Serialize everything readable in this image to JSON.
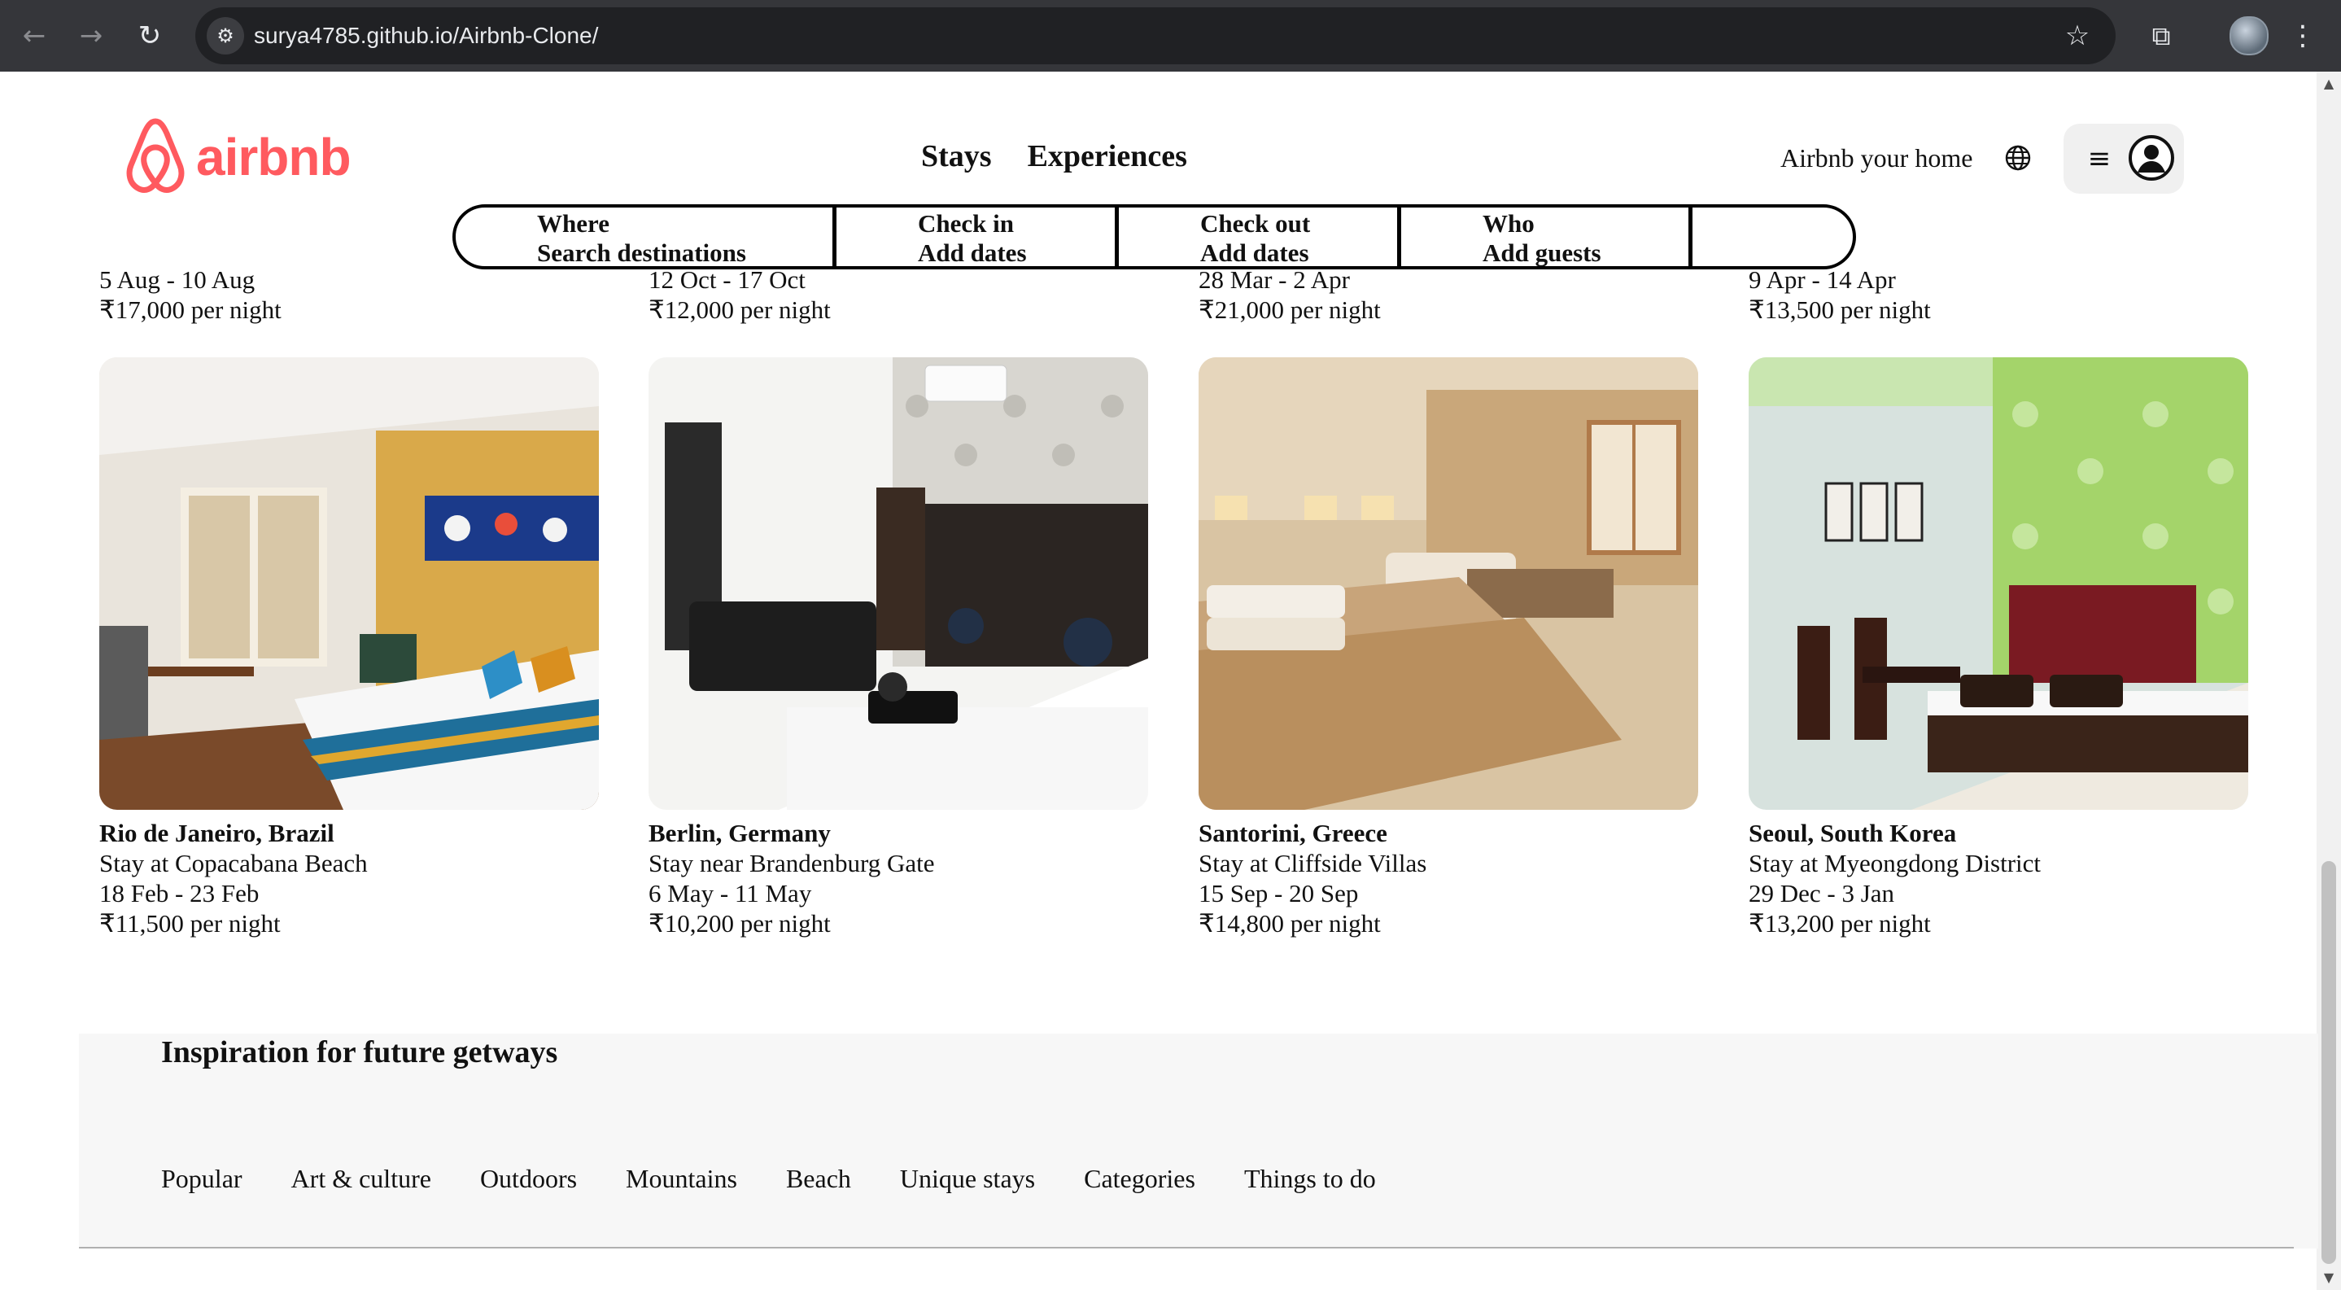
{
  "browser": {
    "url": "surya4785.github.io/Airbnb-Clone/",
    "icons": [
      "back-icon",
      "forward-icon",
      "reload-icon",
      "site-info-icon",
      "bookmark-star-icon",
      "extensions-icon",
      "profile-avatar",
      "kebab-menu-icon"
    ]
  },
  "header": {
    "logo_text": "airbnb",
    "brand_color": "#ff5a5f",
    "nav": {
      "stays": "Stays",
      "experiences": "Experiences"
    },
    "host_link": "Airbnb your home"
  },
  "search": {
    "where": {
      "title": "Where",
      "sub": "Search destinations"
    },
    "check_in": {
      "title": "Check in",
      "sub": "Add dates"
    },
    "check_out": {
      "title": "Check out",
      "sub": "Add dates"
    },
    "who": {
      "title": "Who",
      "sub": "Add guests"
    }
  },
  "previous_row": [
    {
      "dates": "5 Aug - 10 Aug",
      "price": "₹17,000 per night"
    },
    {
      "dates": "12 Oct - 17 Oct",
      "price": "₹12,000 per night"
    },
    {
      "dates": "28 Mar - 2 Apr",
      "price": "₹21,000 per night"
    },
    {
      "dates": "9 Apr - 14 Apr",
      "price": "₹13,500 per night"
    }
  ],
  "listings": [
    {
      "location": "Rio de Janeiro, Brazil",
      "description": "Stay at Copacabana Beach",
      "dates": "18 Feb - 23 Feb",
      "price": "₹11,500 per night"
    },
    {
      "location": "Berlin, Germany",
      "description": "Stay near Brandenburg Gate",
      "dates": "6 May - 11 May",
      "price": "₹10,200 per night"
    },
    {
      "location": "Santorini, Greece",
      "description": "Stay at Cliffside Villas",
      "dates": "15 Sep - 20 Sep",
      "price": "₹14,800 per night"
    },
    {
      "location": "Seoul, South Korea",
      "description": "Stay at Myeongdong District",
      "dates": "29 Dec - 3 Jan",
      "price": "₹13,200 per night"
    }
  ],
  "inspiration": {
    "heading": "Inspiration for future getways",
    "tabs": [
      "Popular",
      "Art & culture",
      "Outdoors",
      "Mountains",
      "Beach",
      "Unique stays",
      "Categories",
      "Things to do"
    ]
  }
}
